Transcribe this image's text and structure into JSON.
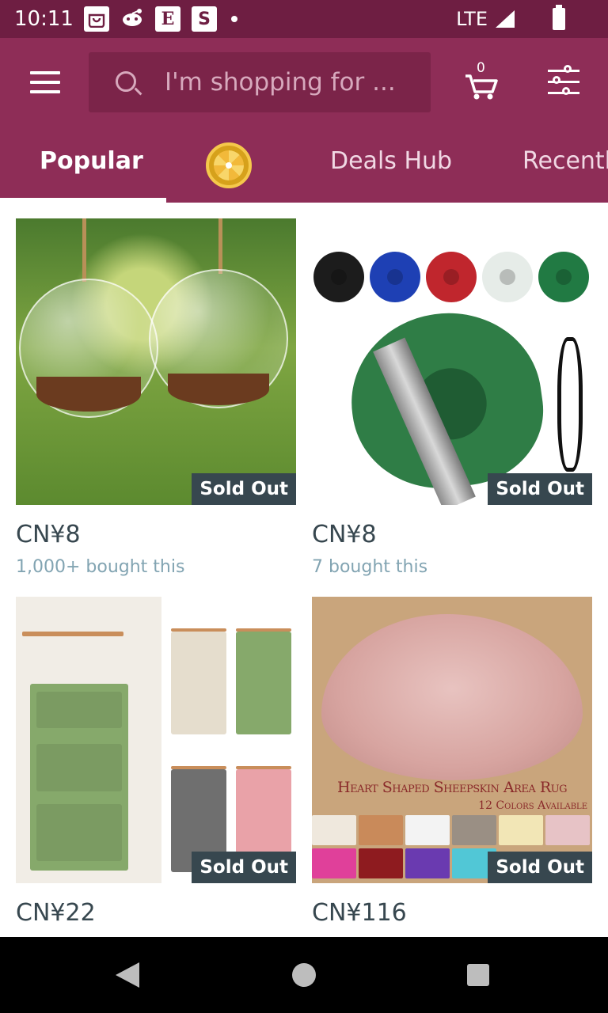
{
  "status_bar": {
    "time": "10:11",
    "network": "LTE",
    "icons": [
      "shopping-bag-icon",
      "reddit-icon",
      "etsy-icon",
      "s-app-icon",
      "notification-dot-icon",
      "signal-icon",
      "battery-icon"
    ],
    "etsy_letter": "E",
    "s_letter": "S"
  },
  "header": {
    "search_placeholder": "I'm shopping for ...",
    "cart_count": "0",
    "background_color": "#8e2d57"
  },
  "tabs": [
    {
      "label": "Popular",
      "active": true
    },
    {
      "label": "Deals Hub",
      "active": false
    },
    {
      "label": "Recently",
      "active": false
    }
  ],
  "products": [
    {
      "price": "CN¥8",
      "bought": "1,000+ bought this",
      "badge": "Sold Out",
      "image": "hanging-glass-terrarium-globes"
    },
    {
      "price": "CN¥8",
      "bought": "7 bought this",
      "badge": "Sold Out",
      "image": "stoneco-velcro-cable-tie-rolls"
    },
    {
      "price": "CN¥22",
      "bought": "",
      "badge": "Sold Out",
      "image": "hanging-wall-pocket-organizers"
    },
    {
      "price": "CN¥116",
      "bought": "",
      "badge": "Sold Out",
      "image": "heart-shaped-sheepskin-rug"
    }
  ],
  "product_images": {
    "rug_title": "Heart Shaped Sheepskin Area Rug",
    "rug_subtitle": "12 Colors Available"
  },
  "nav": {
    "icons": [
      "back-icon",
      "home-icon",
      "recent-apps-icon"
    ]
  }
}
